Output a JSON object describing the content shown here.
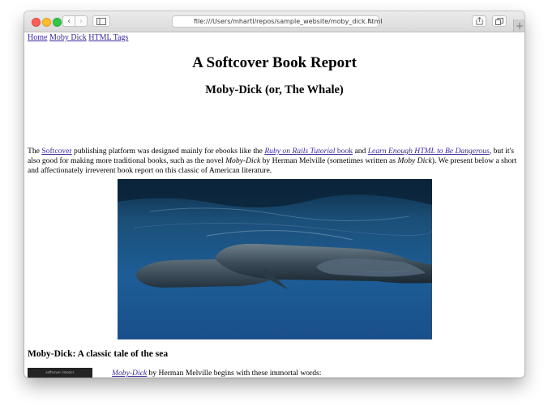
{
  "browser": {
    "url": "file:///Users/mhartl/repos/sample_website/moby_dick.html",
    "icons": [
      "back-icon",
      "forward-icon",
      "sidebar-icon",
      "reload-icon",
      "share-icon",
      "tabs-icon",
      "new-tab-icon"
    ]
  },
  "nav": {
    "home": "Home",
    "moby_dick": "Moby Dick",
    "html_tags": "HTML Tags"
  },
  "page": {
    "title": "A Softcover Book Report",
    "subtitle": "Moby-Dick (or, The Whale)"
  },
  "intro": {
    "t1": "The ",
    "softcover_link": "Softcover",
    "t2": " publishing platform was designed mainly for ebooks like the ",
    "rails_link": "Ruby on Rails Tutorial",
    "book_link": " book",
    "t3": " and ",
    "lehtml_link": "Learn Enough HTML to Be Dangerous",
    "t4": ", but it's also good for making more traditional books, such as the novel ",
    "moby1": "Moby-Dick",
    "t5": " by Herman Melville (sometimes written as ",
    "moby2": "Moby Dick",
    "t6": "). We present below a short and affectionately irreverent book report on this classic of American literature."
  },
  "section": {
    "heading": "Moby-Dick: A classic tale of the sea",
    "cover_text": "softcover classics",
    "quote_link": "Moby-Dick",
    "quote_text": " by Herman Melville begins with these immortal words:"
  }
}
